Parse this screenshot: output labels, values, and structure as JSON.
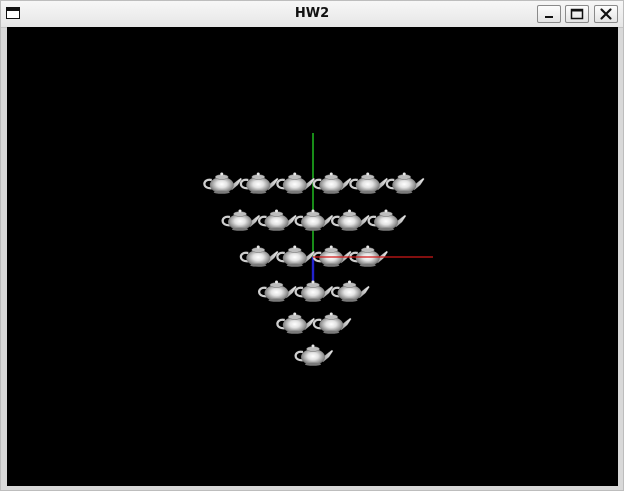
{
  "window": {
    "title": "HW2",
    "controls": [
      "minimize",
      "maximize",
      "close"
    ]
  },
  "scene": {
    "background": "#000000",
    "axes": {
      "x_color": "#d01818",
      "y_color": "#1fb01f",
      "z_color": "#2222cc"
    },
    "object": "teapot",
    "teapot_rows": [
      6,
      5,
      4,
      3,
      2,
      1
    ]
  }
}
